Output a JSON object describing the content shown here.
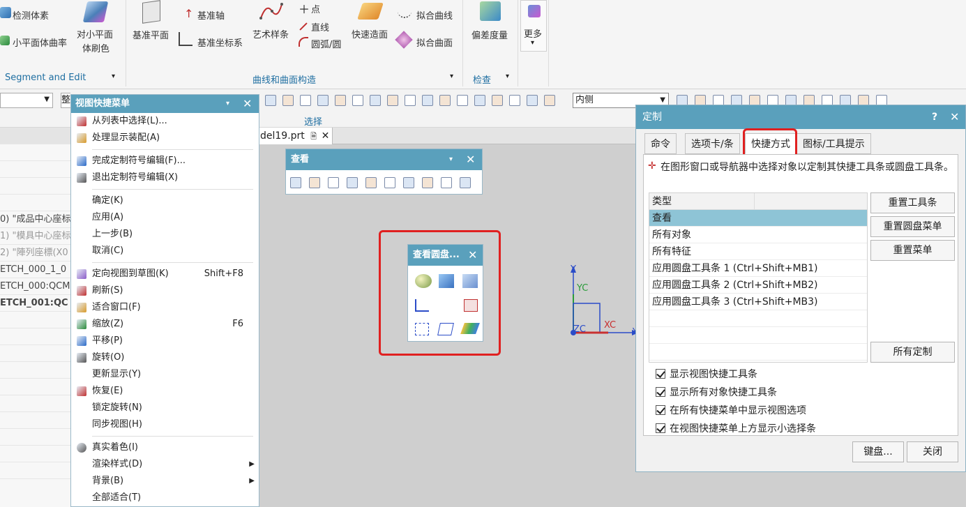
{
  "ribbon": {
    "items": {
      "detect_body": "检测体素",
      "facet_curvature": "小平面体曲率",
      "facet_brush_line1": "对小平面",
      "facet_brush_line2": "体刷色",
      "datum_plane": "基准平面",
      "datum_axis": "基准轴",
      "datum_csys": "基准坐标系",
      "point": "点",
      "line": "直线",
      "arc": "圆弧/圆",
      "studio_spline": "艺术样条",
      "rapid_surfacing": "快速造面",
      "fit_curve": "拟合曲线",
      "fit_surface": "拟合曲面",
      "deviation_gauge": "偏差度量",
      "more": "更多"
    },
    "groups": {
      "segment_edit": "Segment and Edit",
      "curve_surface": "曲线和曲面构造",
      "inspect": "检查"
    }
  },
  "toolbar": {
    "selection_label": "选择",
    "side_filter": "内侧",
    "left_dropdown_text": "整"
  },
  "doc_tab": {
    "name": "del19.prt"
  },
  "leftnav": {
    "rows": [
      "",
      "",
      "",
      "",
      "",
      "0) \"成品中心座标",
      "1) \"模具中心座标",
      "2) \"陣列座標(X0",
      "ETCH_000_1_0",
      "ETCH_000:QCM",
      "ETCH_001:QC",
      "",
      "",
      "",
      "",
      "",
      "",
      "",
      "",
      "",
      ""
    ]
  },
  "view_menu": {
    "title": "视图快捷菜单",
    "items": [
      {
        "label": "从列表中选择(L)...",
        "icon": "crosshair-icon"
      },
      {
        "label": "处理显示装配(A)",
        "icon": "assembly-icon"
      },
      {
        "sep": true
      },
      {
        "label": "完成定制符号编辑(F)...",
        "icon": "symbol-finish-icon"
      },
      {
        "label": "退出定制符号编辑(X)",
        "icon": "symbol-exit-icon"
      },
      {
        "sep": true
      },
      {
        "label": "确定(K)"
      },
      {
        "label": "应用(A)"
      },
      {
        "label": "上一步(B)"
      },
      {
        "label": "取消(C)"
      },
      {
        "sep": true
      },
      {
        "label": "定向视图到草图(K)",
        "shortcut": "Shift+F8",
        "icon": "orient-sketch-icon"
      },
      {
        "label": "刷新(S)",
        "icon": "refresh-icon"
      },
      {
        "label": "适合窗口(F)",
        "icon": "fit-icon"
      },
      {
        "label": "缩放(Z)",
        "shortcut": "F6",
        "icon": "zoom-icon"
      },
      {
        "label": "平移(P)",
        "icon": "pan-icon"
      },
      {
        "label": "旋转(O)",
        "icon": "rotate-icon"
      },
      {
        "label": "更新显示(Y)"
      },
      {
        "label": "恢复(E)",
        "icon": "restore-icon"
      },
      {
        "label": "锁定旋转(N)"
      },
      {
        "label": "同步视图(H)"
      },
      {
        "sep": true
      },
      {
        "label": "真实着色(I)",
        "icon": "true-shading-icon"
      },
      {
        "label": "渲染样式(D)",
        "submenu": true
      },
      {
        "label": "背景(B)",
        "submenu": true
      },
      {
        "label": "全部适合(T)"
      }
    ]
  },
  "view_toolbar": {
    "title": "查看"
  },
  "radial_panel": {
    "title": "查看圆盘..."
  },
  "axes": {
    "y": "Y",
    "yc": "YC",
    "zc": "ZC",
    "xc": "XC",
    "x": "X"
  },
  "customize_dialog": {
    "title": "定制",
    "help": "?",
    "tabs": [
      "命令",
      "选项卡/条",
      "快捷方式",
      "图标/工具提示"
    ],
    "active_tab": "快捷方式",
    "instruction": "在图形窗口或导航器中选择对象以定制其快捷工具条或圆盘工具条。",
    "list_header": "类型",
    "list_items": [
      "查看",
      "所有对象",
      "所有特征",
      "应用圆盘工具条 1 (Ctrl+Shift+MB1)",
      "应用圆盘工具条 2 (Ctrl+Shift+MB2)",
      "应用圆盘工具条 3 (Ctrl+Shift+MB3)"
    ],
    "selected_item": "查看",
    "buttons": {
      "reset_toolbar": "重置工具条",
      "reset_radial": "重置圆盘菜单",
      "reset_menu": "重置菜单",
      "all_customize": "所有定制",
      "keyboard": "键盘...",
      "close": "关闭"
    },
    "checkboxes": [
      "显示视图快捷工具条",
      "显示所有对象快捷工具条",
      "在所有快捷菜单中显示视图选项",
      "在视图快捷菜单上方显示小选择条"
    ]
  },
  "colors": {
    "accent": "#5aa0bc",
    "highlight": "#e02020",
    "selected_row": "#8ec4d6"
  }
}
